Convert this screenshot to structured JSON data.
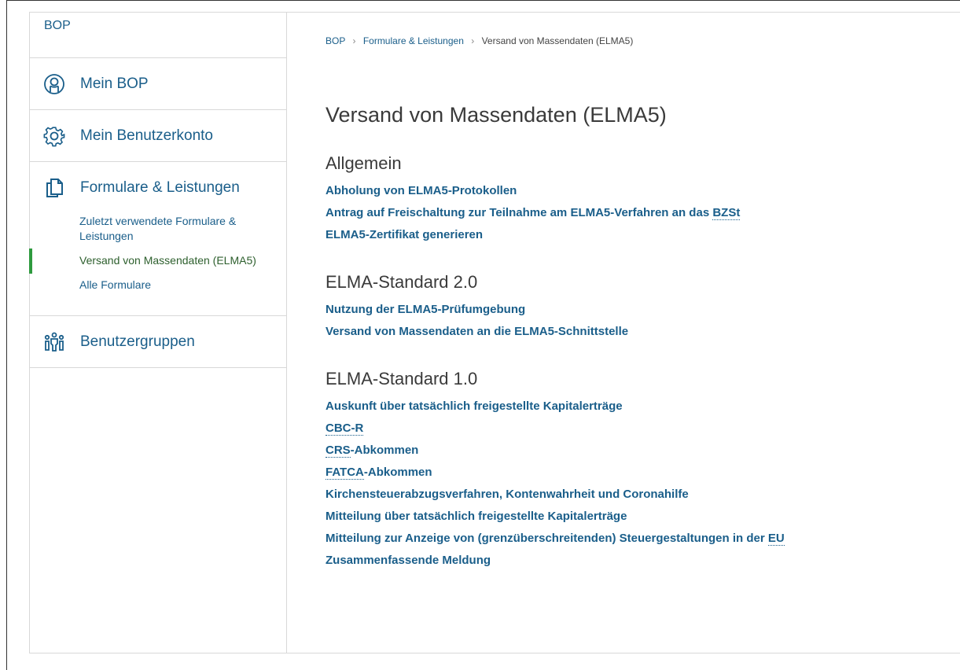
{
  "sidebar": {
    "top_label": "BOP",
    "items": [
      {
        "label": "Mein BOP",
        "icon": "user-circle-icon"
      },
      {
        "label": "Mein Benutzerkonto",
        "icon": "gear-icon"
      },
      {
        "label": "Formulare & Leistungen",
        "icon": "documents-icon",
        "children": [
          {
            "label": "Zuletzt verwendete Formulare & Leistungen"
          },
          {
            "label": "Versand von Massendaten (ELMA5)",
            "active": true
          },
          {
            "label": "Alle Formulare"
          }
        ]
      },
      {
        "label": "Benutzergruppen",
        "icon": "user-group-icon"
      }
    ]
  },
  "breadcrumb": {
    "items": [
      "BOP",
      "Formulare & Leistungen",
      "Versand von Massendaten (ELMA5)"
    ],
    "separator": "›"
  },
  "main": {
    "title": "Versand von Massendaten (ELMA5)",
    "sections": [
      {
        "heading": "Allgemein",
        "links": [
          {
            "text": "Abholung von ELMA5-Protokollen"
          },
          {
            "pre": "Antrag auf Freischaltung zur Teilnahme am ELMA5-Verfahren an das ",
            "abbr": "BZSt",
            "post": ""
          },
          {
            "text": "ELMA5-Zertifikat generieren"
          }
        ]
      },
      {
        "heading": "ELMA-Standard 2.0",
        "links": [
          {
            "text": "Nutzung der ELMA5-Prüfumgebung"
          },
          {
            "text": "Versand von Massendaten an die ELMA5-Schnittstelle"
          }
        ]
      },
      {
        "heading": "ELMA-Standard 1.0",
        "links": [
          {
            "text": "Auskunft über tatsächlich freigestellte Kapitalerträge"
          },
          {
            "pre": "",
            "abbr": "CBC-R",
            "post": ""
          },
          {
            "pre": "",
            "abbr": "CRS",
            "post": "-Abkommen"
          },
          {
            "pre": "",
            "abbr": "FATCA",
            "post": "-Abkommen"
          },
          {
            "text": "Kirchensteuerabzugsverfahren, Kontenwahrheit und Coronahilfe"
          },
          {
            "text": "Mitteilung über tatsächlich freigestellte Kapitalerträge"
          },
          {
            "pre": "Mitteilung zur Anzeige von (grenzüberschreitenden) Steuergestaltungen in der ",
            "abbr": "EU",
            "post": ""
          },
          {
            "text": "Zusammenfassende Meldung"
          }
        ]
      }
    ]
  },
  "colors": {
    "link": "#1a5e8a",
    "text": "#3a3a3a",
    "active_marker": "#2e9a3e",
    "active_text": "#2d5f2d",
    "divider": "#d8d8d8"
  }
}
